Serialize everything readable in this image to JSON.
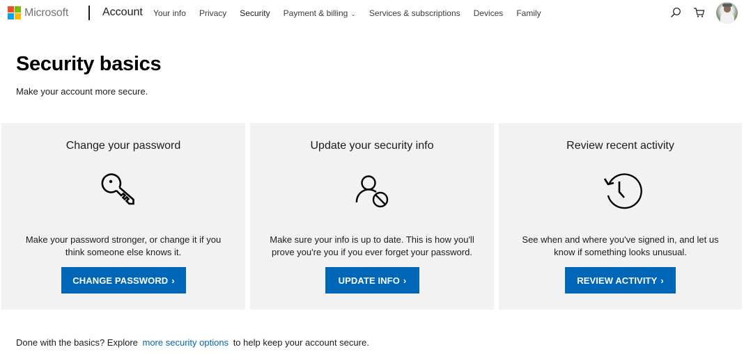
{
  "header": {
    "brand": "Microsoft",
    "section": "Account",
    "logo_colors": [
      "#f25022",
      "#7fba00",
      "#00a4ef",
      "#ffb900"
    ],
    "nav": [
      {
        "label": "Your info",
        "active": false
      },
      {
        "label": "Privacy",
        "active": false
      },
      {
        "label": "Security",
        "active": true
      },
      {
        "label": "Payment & billing",
        "active": false,
        "has_dropdown": true
      },
      {
        "label": "Services & subscriptions",
        "active": false
      },
      {
        "label": "Devices",
        "active": false
      },
      {
        "label": "Family",
        "active": false
      }
    ],
    "icons": {
      "search": "search-icon",
      "cart": "cart-icon",
      "avatar": "user-avatar"
    }
  },
  "page": {
    "title": "Security basics",
    "subtitle": "Make your account more secure."
  },
  "cards": [
    {
      "title": "Change your password",
      "icon": "key-icon",
      "description": "Make your password stronger, or change it if you think someone else knows it.",
      "button": "CHANGE PASSWORD",
      "arrow": "›"
    },
    {
      "title": "Update your security info",
      "icon": "user-blocked-icon",
      "description": "Make sure your info is up to date. This is how you'll prove you're you if you ever forget your password.",
      "button": "UPDATE INFO",
      "arrow": "›"
    },
    {
      "title": "Review recent activity",
      "icon": "history-icon",
      "description": "See when and where you've signed in, and let us know if something looks unusual.",
      "button": "REVIEW ACTIVITY",
      "arrow": "›"
    }
  ],
  "footer": {
    "prefix": "Done with the basics? Explore",
    "link": "more security options",
    "suffix": "to help keep your account secure."
  },
  "colors": {
    "accent": "#0067b8",
    "card_bg": "#f2f2f2"
  }
}
